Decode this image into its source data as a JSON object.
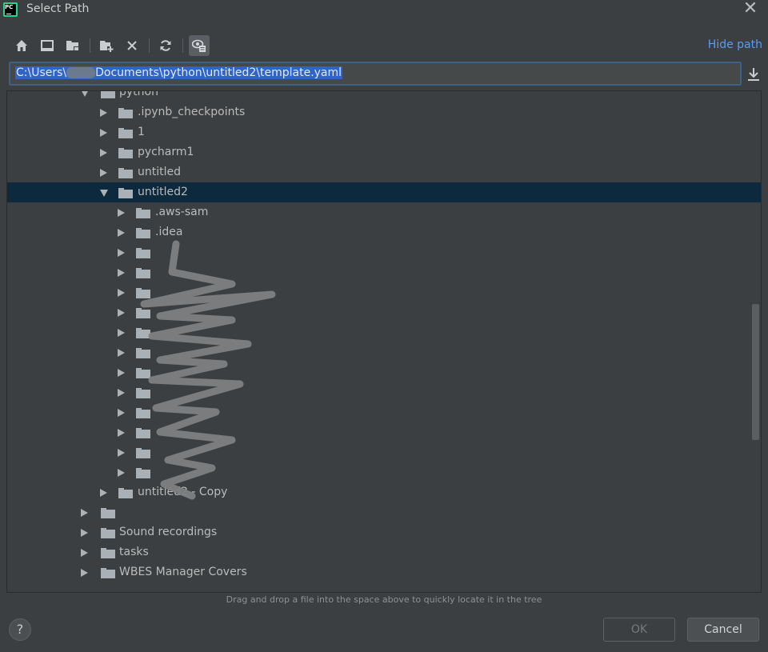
{
  "window": {
    "title": "Select Path",
    "app_icon_text": "PC"
  },
  "toolbar": {
    "buttons": [
      {
        "icon": "home-icon"
      },
      {
        "icon": "desktop-icon"
      },
      {
        "icon": "project-folder-icon"
      },
      {
        "icon": "new-folder-icon"
      },
      {
        "icon": "delete-icon"
      },
      {
        "icon": "refresh-icon"
      },
      {
        "icon": "show-hidden-files-icon",
        "active": true
      }
    ],
    "hide_path_label": "Hide path"
  },
  "path": {
    "prefix": "C:\\Users\\",
    "suffix": "Documents\\python\\untitled2\\template.yaml"
  },
  "tree": {
    "rows": [
      {
        "label": "python",
        "level": 1,
        "expanded": true
      },
      {
        "label": ".ipynb_checkpoints",
        "level": 2
      },
      {
        "label": "1",
        "level": 2
      },
      {
        "label": "pycharm1",
        "level": 2
      },
      {
        "label": "untitled",
        "level": 2
      },
      {
        "label": "untitled2",
        "level": 2,
        "expanded": true,
        "selected": true
      },
      {
        "label": ".aws-sam",
        "level": 3
      },
      {
        "label": ".idea",
        "level": 3
      },
      {
        "label": "",
        "level": 3
      },
      {
        "label": "",
        "level": 3
      },
      {
        "label": "",
        "level": 3
      },
      {
        "label": "",
        "level": 3
      },
      {
        "label": "",
        "level": 3
      },
      {
        "label": "",
        "level": 3
      },
      {
        "label": "",
        "level": 3
      },
      {
        "label": "",
        "level": 3
      },
      {
        "label": "",
        "level": 3
      },
      {
        "label": "",
        "level": 3
      },
      {
        "label": "",
        "level": 3
      },
      {
        "label": "",
        "level": 3
      },
      {
        "label": "untitled2 - Copy",
        "level": 2
      },
      {
        "label": "",
        "level": 1
      },
      {
        "label": "Sound recordings",
        "level": 1
      },
      {
        "label": "tasks",
        "level": 1
      },
      {
        "label": "WBES Manager Covers",
        "level": 1
      }
    ]
  },
  "hint": "Drag and drop a file into the space above to quickly locate it in the tree",
  "buttons": {
    "help": "?",
    "ok": "OK",
    "cancel": "Cancel"
  }
}
